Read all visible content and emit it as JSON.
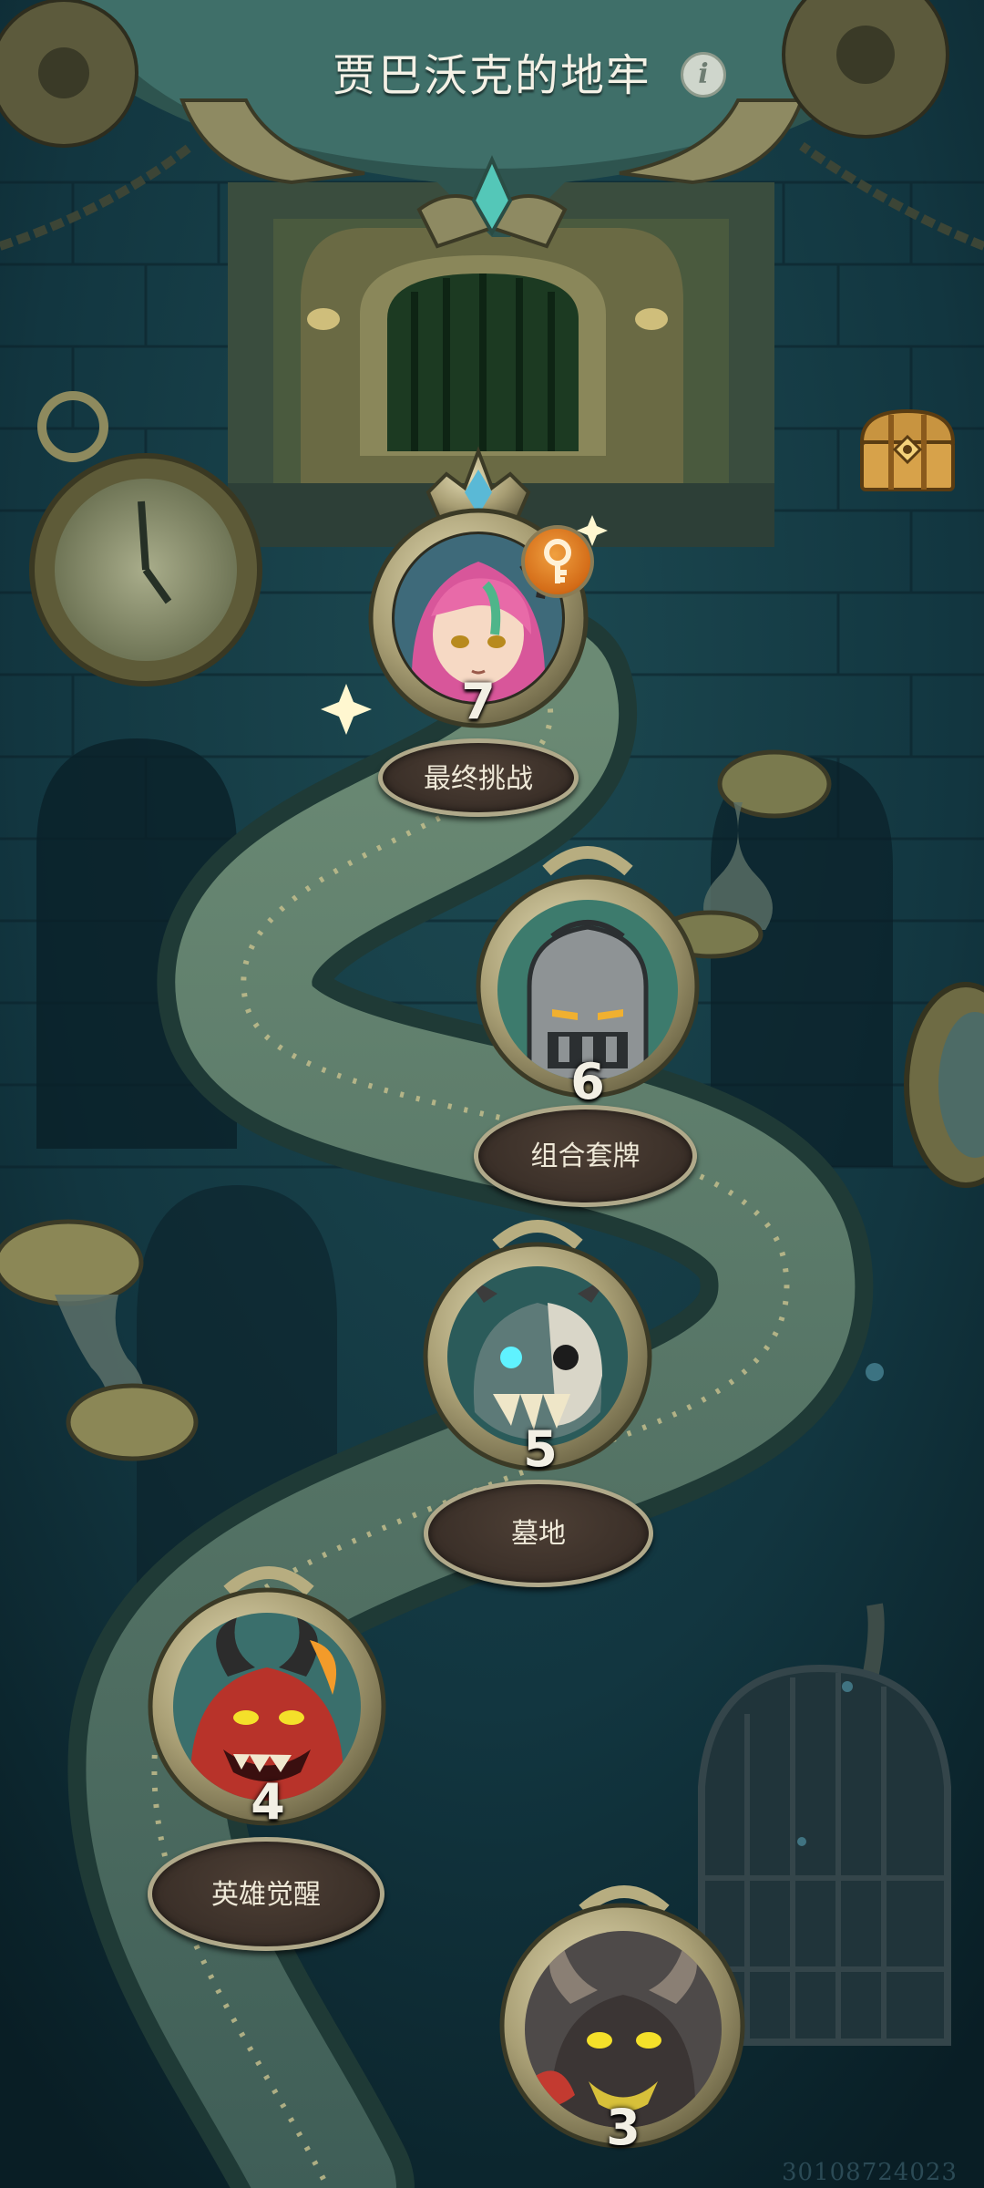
{
  "header": {
    "title": "贾巴沃克的地牢",
    "info_icon": "info-icon",
    "info_glyph": "i"
  },
  "reward_chest": {
    "icon": "treasure-chest-icon"
  },
  "stages": [
    {
      "number": "7",
      "label": "最终挑战",
      "portrait": "pink-haired-elf-boss",
      "badge": "key-icon"
    },
    {
      "number": "6",
      "label": "组合套牌",
      "portrait": "iron-helmet-knight"
    },
    {
      "number": "5",
      "label": "墓地",
      "portrait": "skull-dragon"
    },
    {
      "number": "4",
      "label": "英雄觉醒",
      "portrait": "red-horned-demon"
    },
    {
      "number": "3",
      "label": "",
      "portrait": "black-horned-dragon"
    }
  ],
  "watermark": "30108724023",
  "colors": {
    "background": "#0e2a33",
    "frame": "#b0a98a",
    "plate": "#3a2f28",
    "text": "#efe9d8"
  }
}
